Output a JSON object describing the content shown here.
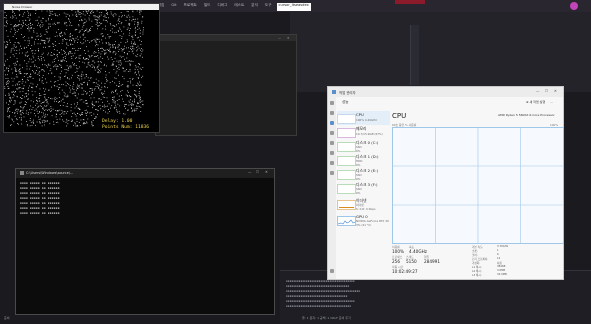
{
  "ide": {
    "tabs": [
      "문서 편집",
      "Git",
      "프로젝트",
      "빌드",
      "디버그",
      "테스트",
      "분석",
      "도구"
    ],
    "branch_tab": "cursor_itseasdex",
    "status_link": "Git 변경",
    "status_bar": "줄: 1   문자: 1   공백: 1   CRLF   준비   추가",
    "left_status": "준비",
    "colors": {
      "accent": "#8b1b2b",
      "user": "#c145b8"
    }
  },
  "noise_window": {
    "title": "Noise Drawer",
    "label_1": "Delay: 1.00",
    "label_2": "Points Num: 11836"
  },
  "console": {
    "title": "C:\\Users\\Windows\\source\\..."
  },
  "task_manager": {
    "title": "작업 관리자",
    "section": "성능",
    "run_task": "새 작업 실행",
    "tiles": [
      {
        "label": "CPU",
        "sub": "100% 4.40GHz",
        "icon": "cpu-graph-icon"
      },
      {
        "label": "메모리",
        "sub": "10.7/15.9GB (67%)",
        "icon": "memory-graph-icon"
      },
      {
        "label": "디스크 0 (C:)",
        "sub": "SSD",
        "sub2": "0%",
        "icon": "disk-graph-icon"
      },
      {
        "label": "디스크 1 (D:)",
        "sub": "HDD",
        "sub2": "0%",
        "icon": "disk-graph-icon"
      },
      {
        "label": "디스크 2 (E:)",
        "sub": "SSD",
        "sub2": "0%",
        "icon": "disk-graph-icon"
      },
      {
        "label": "디스크 3 (F:)",
        "sub": "SSD",
        "sub2": "0%",
        "icon": "disk-graph-icon"
      },
      {
        "label": "이더넷",
        "sub": "이더넷",
        "sub2": "S: 0 R: 0 Kbps",
        "icon": "ethernet-graph-icon"
      },
      {
        "label": "GPU 0",
        "sub": "NVIDIA GeForce RTX 30",
        "sub2": "3% (41 °C)",
        "icon": "gpu-graph-icon"
      }
    ],
    "main_title": "CPU",
    "processor": "AMD Ryzen 5 5600X 6-Core Processor",
    "util_label": "60초 동안 % 사용률",
    "util_max": "100%",
    "stats": {
      "util_label": "이용률",
      "util": "100%",
      "speed_label": "속도",
      "speed": "4.40GHz",
      "proc_label": "프로세스",
      "proc": "256",
      "thread_label": "스레드",
      "thread": "5150",
      "handle_label": "핸들",
      "handle": "284991",
      "uptime_label": "작동 시간",
      "uptime": "10:02:49:27"
    },
    "specs": [
      [
        "기본 속도:",
        "3.70GHz"
      ],
      [
        "소켓:",
        "1"
      ],
      [
        "코어:",
        "6"
      ],
      [
        "논리 프로세서:",
        "12"
      ],
      [
        "가상화:",
        "사용"
      ],
      [
        "L1 캐시:",
        "384KB"
      ],
      [
        "L2 캐시:",
        "3.0MB"
      ],
      [
        "L3 캐시:",
        "32.0MB"
      ]
    ],
    "colors": {
      "graph_border": "#9ec7ea",
      "graph_fill": "#e4eef8"
    }
  }
}
